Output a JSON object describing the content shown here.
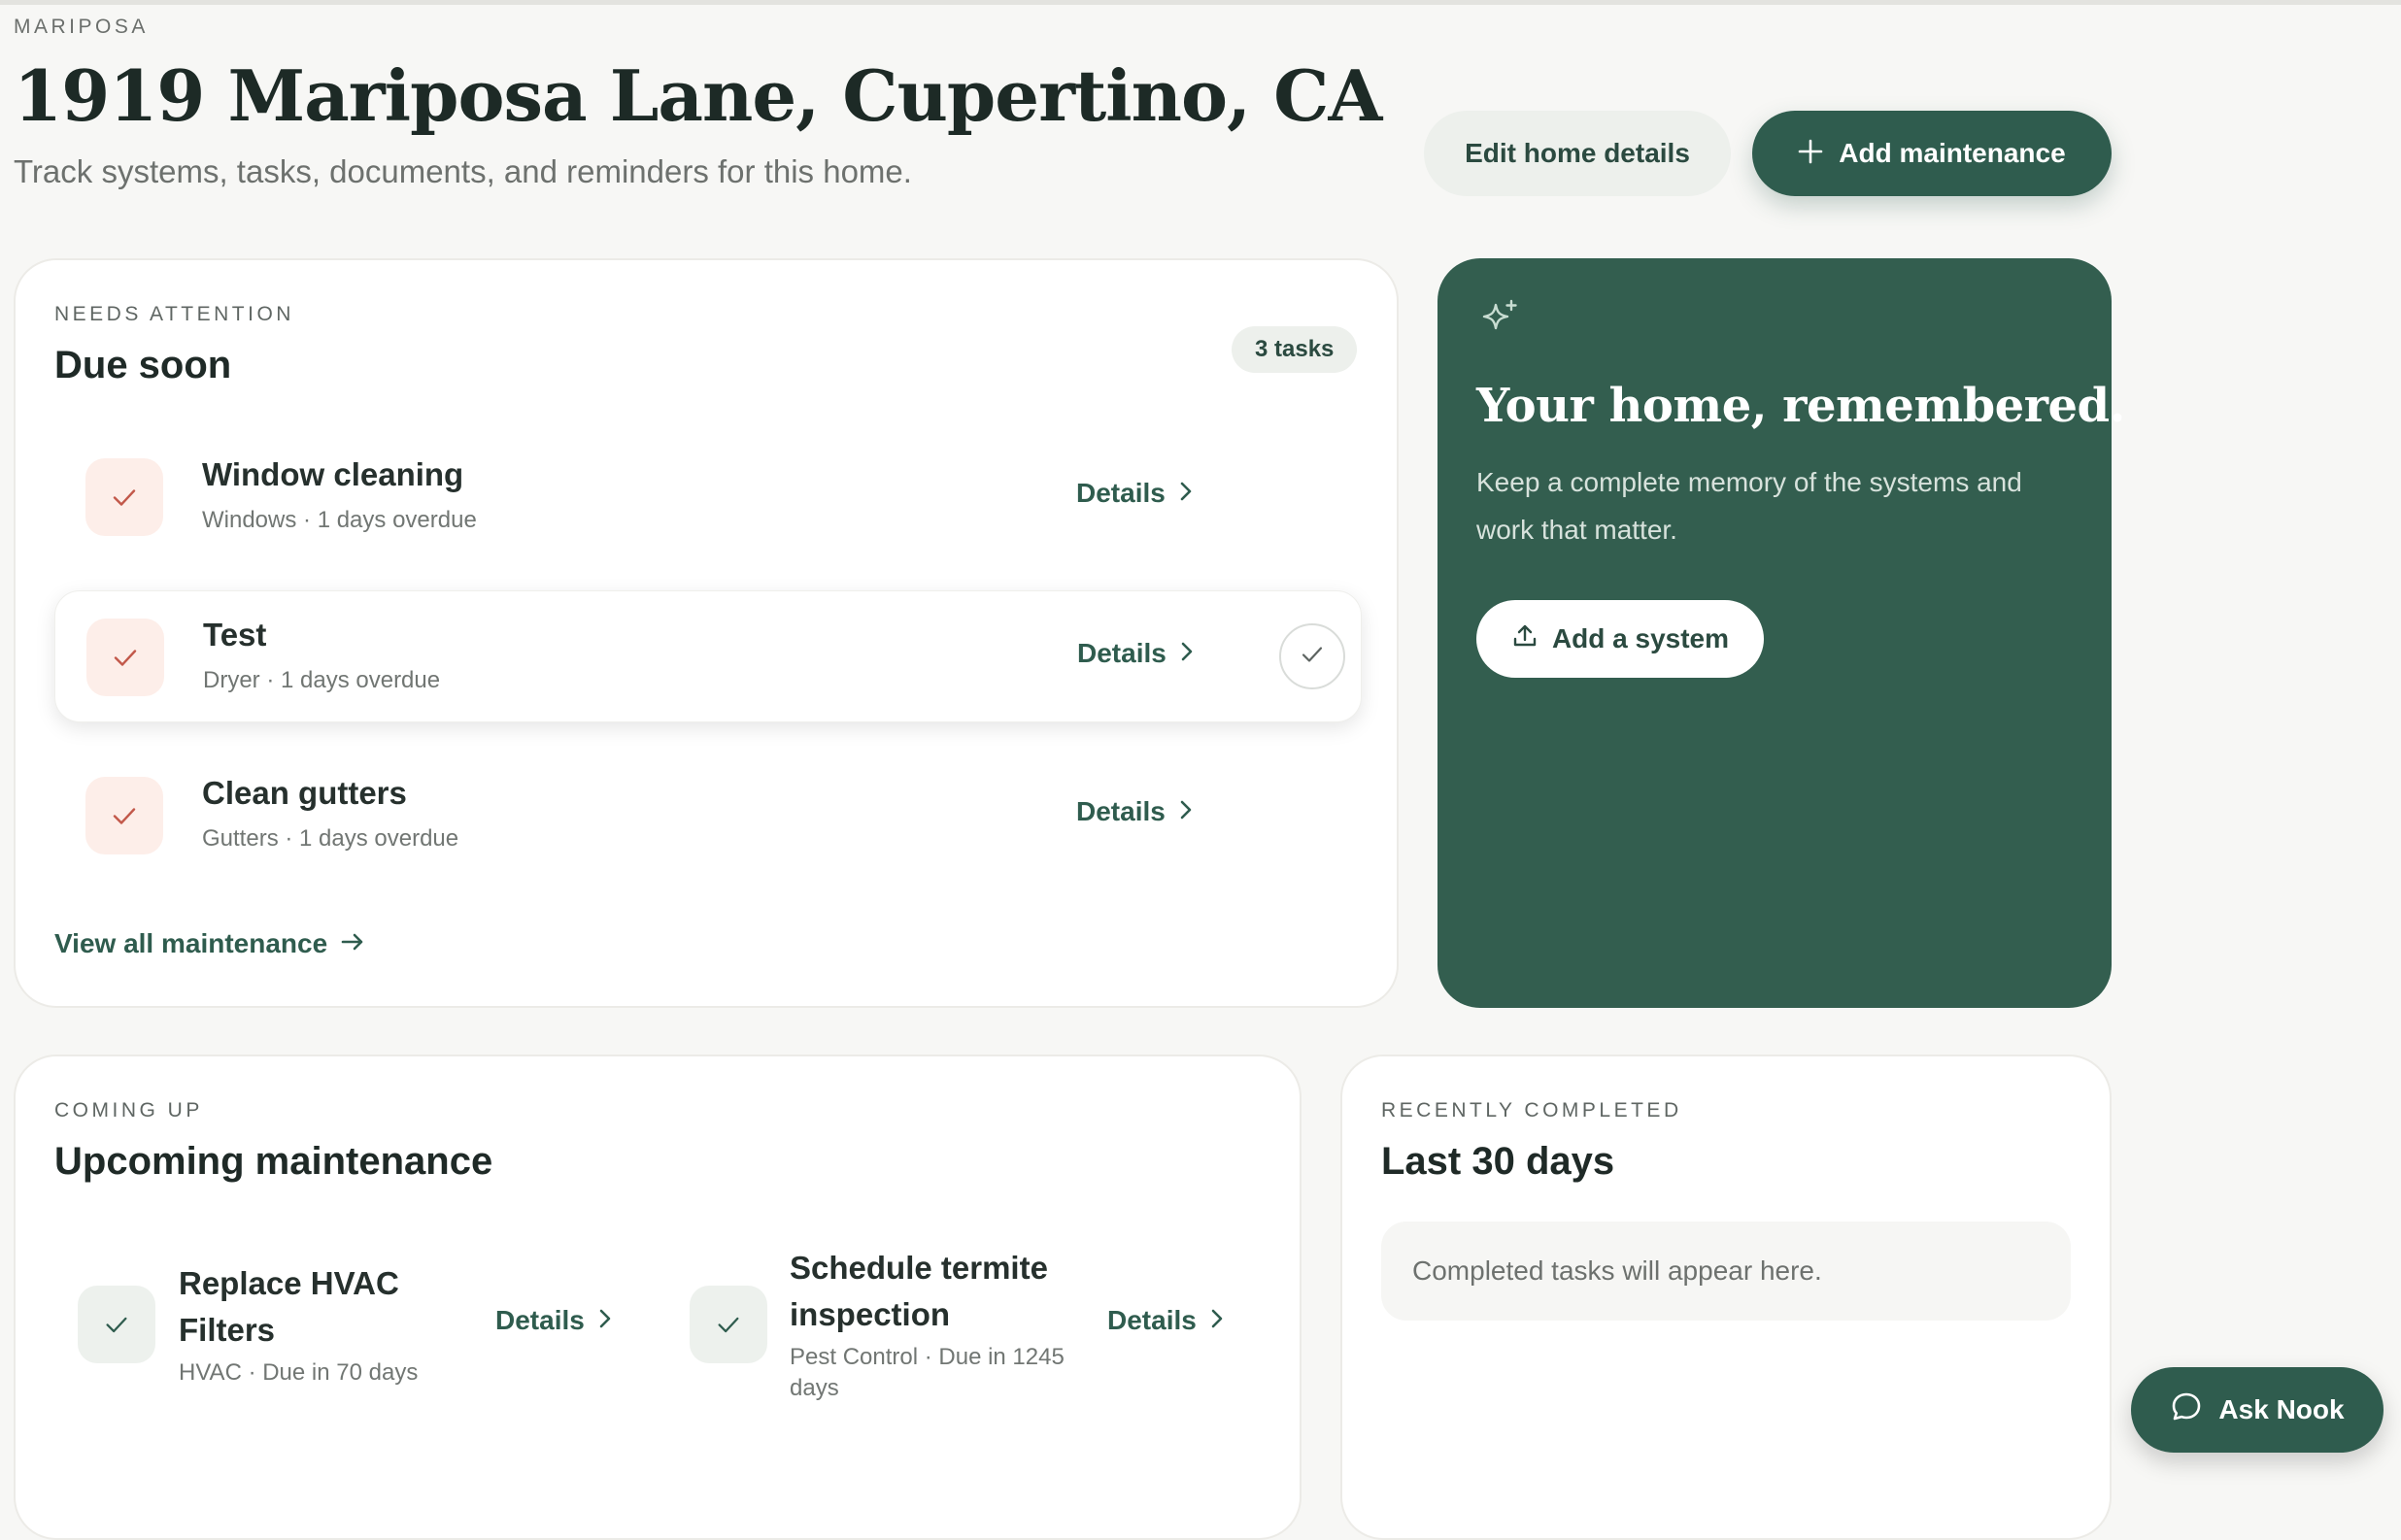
{
  "header": {
    "eyebrow": "MARIPOSA",
    "title": "1919 Mariposa Lane, Cupertino, CA",
    "subtitle": "Track systems, tasks, documents, and reminders for this home.",
    "edit_label": "Edit home details",
    "add_label": "Add maintenance"
  },
  "attention": {
    "eyebrow": "NEEDS ATTENTION",
    "title": "Due soon",
    "badge": "3 tasks",
    "tasks": [
      {
        "name": "Window cleaning",
        "meta": "Windows · 1 days overdue",
        "details": "Details"
      },
      {
        "name": "Test",
        "meta": "Dryer · 1 days overdue",
        "details": "Details"
      },
      {
        "name": "Clean gutters",
        "meta": "Gutters · 1 days overdue",
        "details": "Details"
      }
    ],
    "view_all": "View all maintenance"
  },
  "promo": {
    "title": "Your home, remembered.",
    "body": "Keep a complete memory of the systems and work that matter.",
    "button": "Add a system"
  },
  "upcoming": {
    "eyebrow": "COMING UP",
    "title": "Upcoming maintenance",
    "items": [
      {
        "name": "Replace HVAC Filters",
        "meta": "HVAC · Due in 70 days",
        "details": "Details"
      },
      {
        "name": "Schedule termite inspection",
        "meta": "Pest Control · Due in 1245 days",
        "details": "Details"
      }
    ]
  },
  "completed": {
    "eyebrow": "RECENTLY COMPLETED",
    "title": "Last 30 days",
    "empty": "Completed tasks will appear here."
  },
  "assistant": {
    "label": "Ask Nook"
  },
  "colors": {
    "brand": "#2f5c4e",
    "promo_bg": "#335e4f",
    "overdue_bg": "#fdeee9",
    "overdue_check": "#c2584a"
  }
}
